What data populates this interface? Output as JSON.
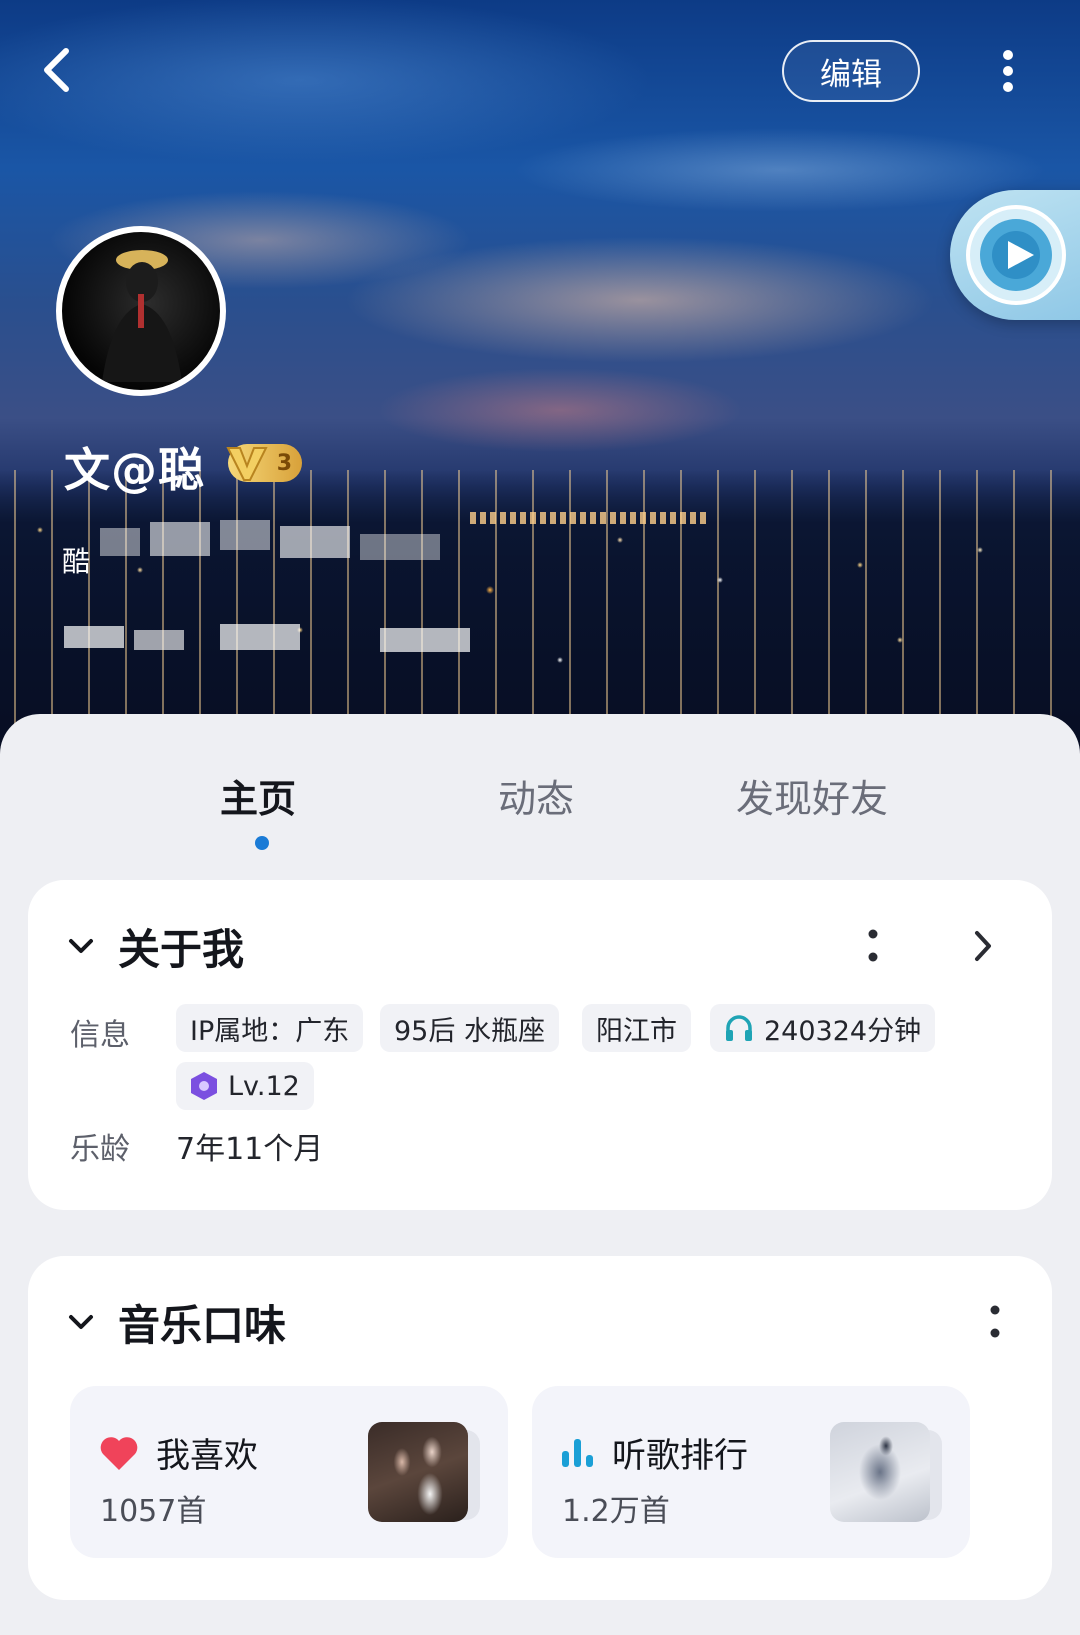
{
  "header": {
    "edit_label": "编辑",
    "icons": {
      "back": "back-arrow-icon",
      "more": "more-vertical-icon",
      "player": "music-player-disc-icon"
    }
  },
  "profile": {
    "nickname": "文@聪",
    "vip_level": "3",
    "signature_prefix": "酷"
  },
  "tabs": [
    {
      "label": "主页",
      "active": true
    },
    {
      "label": "动态",
      "active": false
    },
    {
      "label": "发现好友",
      "active": false
    }
  ],
  "about": {
    "title": "关于我",
    "info_label": "信息",
    "chips": [
      "IP属地：广东",
      "95后 水瓶座",
      "阳江市",
      "240324分钟",
      "Lv.12"
    ],
    "age_label": "乐龄",
    "age_value": "7年11个月"
  },
  "taste": {
    "title": "音乐口味",
    "tiles": [
      {
        "title": "我喜欢",
        "count": "1057首",
        "icon": "heart-icon"
      },
      {
        "title": "听歌排行",
        "count": "1.2万首",
        "icon": "bar-chart-icon"
      }
    ]
  },
  "colors": {
    "accent": "#1a7bd6",
    "heart": "#f0435a",
    "rank_icon": "#1a9fd6",
    "vip_gold": "#e8bf5a",
    "level_purple": "#7b4fe0",
    "headphone_teal": "#1fa4b5"
  }
}
